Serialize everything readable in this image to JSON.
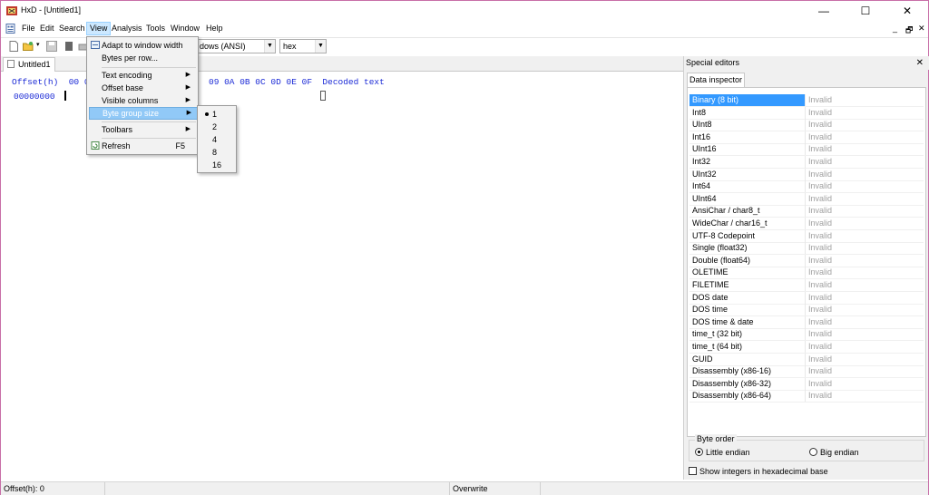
{
  "window": {
    "title": "HxD - [Untitled1]",
    "controls": {
      "minimize": "—",
      "maximize": "☐",
      "close": "✕"
    },
    "mdi_controls": {
      "minimize": "_",
      "restore": "🗗",
      "close": "✕"
    }
  },
  "menubar": {
    "items": [
      "File",
      "Edit",
      "Search",
      "View",
      "Analysis",
      "Tools",
      "Window",
      "Help"
    ],
    "active": "View"
  },
  "toolbar": {
    "encoding_value": "dows (ANSI)",
    "base_value": "hex"
  },
  "tabs": {
    "document": "Untitled1"
  },
  "editor": {
    "header_left": "Offset(h)  00 0",
    "header_right": "09 0A 0B 0C 0D 0E 0F  Decoded text",
    "first_offset": "00000000"
  },
  "view_menu": {
    "items": [
      {
        "label": "Adapt to window width",
        "icon": "adapt-width-icon"
      },
      {
        "label": "Bytes per row..."
      },
      {
        "label": "Text encoding",
        "submenu": true
      },
      {
        "label": "Offset base",
        "submenu": true
      },
      {
        "label": "Visible columns",
        "submenu": true
      },
      {
        "label": "Byte group size",
        "submenu": true,
        "highlighted": true
      },
      {
        "label": "Toolbars",
        "submenu": true
      },
      {
        "label": "Refresh",
        "shortcut": "F5",
        "icon": "refresh-icon"
      }
    ]
  },
  "byte_group_submenu": {
    "options": [
      "1",
      "2",
      "4",
      "8",
      "16"
    ],
    "selected": "1"
  },
  "special_editors": {
    "title": "Special editors",
    "close": "✕",
    "tab": "Data inspector",
    "rows": [
      {
        "name": "Binary (8 bit)",
        "value": "Invalid",
        "selected": true
      },
      {
        "name": "Int8",
        "value": "Invalid"
      },
      {
        "name": "UInt8",
        "value": "Invalid"
      },
      {
        "name": "Int16",
        "value": "Invalid"
      },
      {
        "name": "UInt16",
        "value": "Invalid"
      },
      {
        "name": "Int32",
        "value": "Invalid"
      },
      {
        "name": "UInt32",
        "value": "Invalid"
      },
      {
        "name": "Int64",
        "value": "Invalid"
      },
      {
        "name": "UInt64",
        "value": "Invalid"
      },
      {
        "name": "AnsiChar / char8_t",
        "value": "Invalid"
      },
      {
        "name": "WideChar / char16_t",
        "value": "Invalid"
      },
      {
        "name": "UTF-8 Codepoint",
        "value": "Invalid"
      },
      {
        "name": "Single (float32)",
        "value": "Invalid"
      },
      {
        "name": "Double (float64)",
        "value": "Invalid"
      },
      {
        "name": "OLETIME",
        "value": "Invalid"
      },
      {
        "name": "FILETIME",
        "value": "Invalid"
      },
      {
        "name": "DOS date",
        "value": "Invalid"
      },
      {
        "name": "DOS time",
        "value": "Invalid"
      },
      {
        "name": "DOS time & date",
        "value": "Invalid"
      },
      {
        "name": "time_t (32 bit)",
        "value": "Invalid"
      },
      {
        "name": "time_t (64 bit)",
        "value": "Invalid"
      },
      {
        "name": "GUID",
        "value": "Invalid"
      },
      {
        "name": "Disassembly (x86-16)",
        "value": "Invalid"
      },
      {
        "name": "Disassembly (x86-32)",
        "value": "Invalid"
      },
      {
        "name": "Disassembly (x86-64)",
        "value": "Invalid"
      }
    ],
    "byte_order": {
      "legend": "Byte order",
      "little": "Little endian",
      "big": "Big endian",
      "selected": "little"
    },
    "hex_checkbox": "Show integers in hexadecimal base"
  },
  "statusbar": {
    "offset": "Offset(h): 0",
    "mode": "Overwrite"
  },
  "colors": {
    "editor_text": "#1c2bd6",
    "selection": "#3399ff",
    "menu_highlight": "#91c9f7",
    "window_border": "#c86fa8"
  }
}
